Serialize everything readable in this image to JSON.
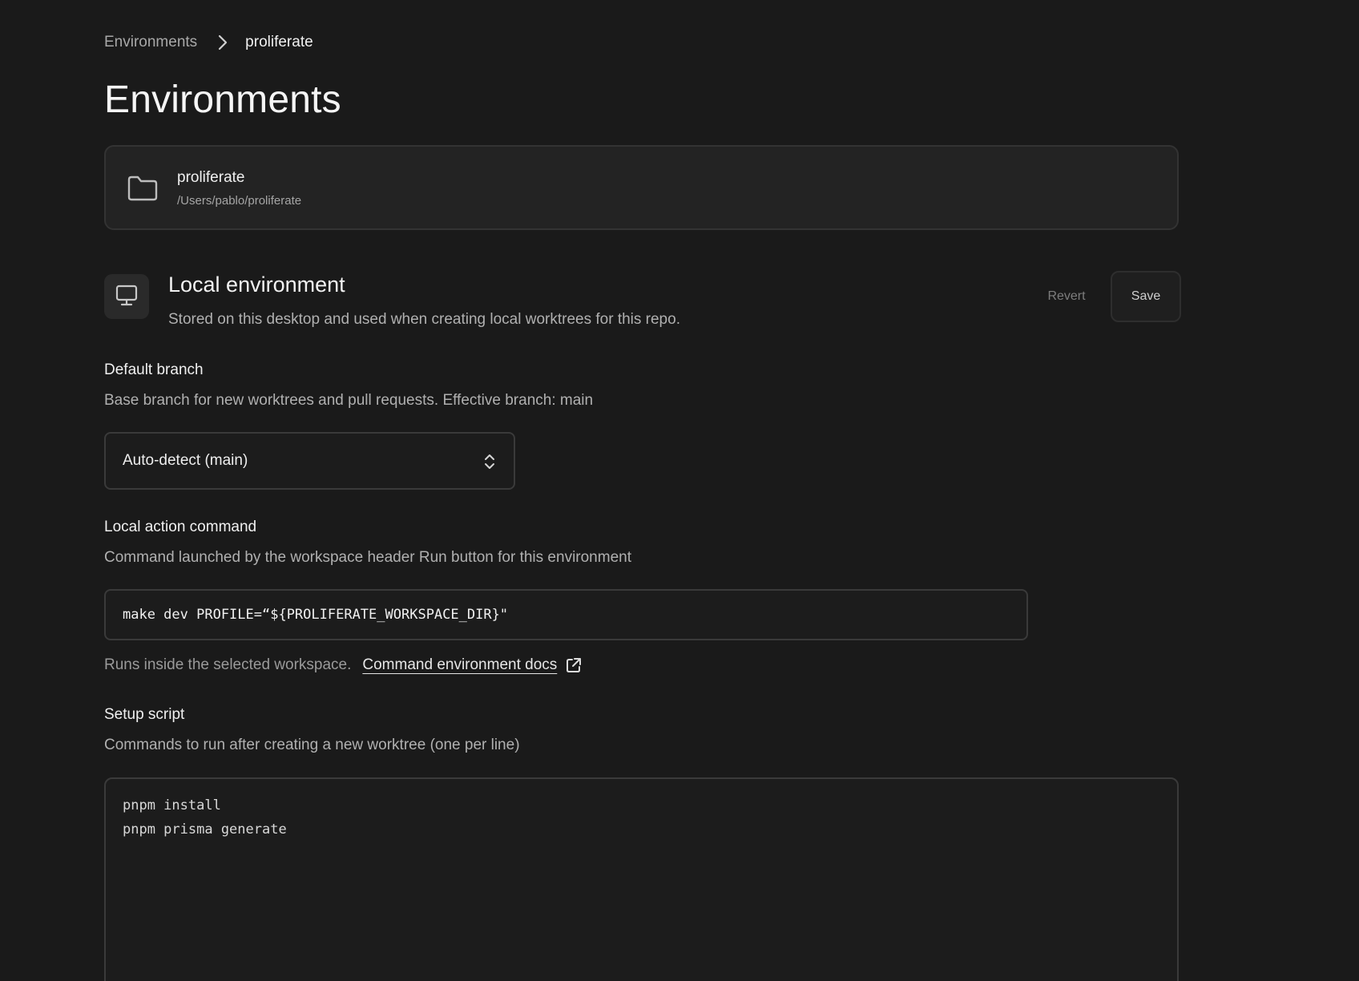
{
  "breadcrumb": {
    "root": "Environments",
    "current": "proliferate"
  },
  "page_title": "Environments",
  "repo": {
    "name": "proliferate",
    "path": "/Users/pablo/proliferate",
    "icon": "folder-icon"
  },
  "local_env": {
    "icon": "monitor-icon",
    "title": "Local environment",
    "description": "Stored on this desktop and used when creating local worktrees for this repo.",
    "revert_label": "Revert",
    "save_label": "Save"
  },
  "default_branch": {
    "label": "Default branch",
    "description": "Base branch for new worktrees and pull requests. Effective branch: main",
    "selected": "Auto-detect (main)"
  },
  "local_action": {
    "label": "Local action command",
    "description": "Command launched by the workspace header Run button for this environment",
    "value": "make dev PROFILE=“${PROLIFERATE_WORKSPACE_DIR}\"",
    "hint": "Runs inside the selected workspace.",
    "docs_link": "Command environment docs"
  },
  "setup_script": {
    "label": "Setup script",
    "description": "Commands to run after creating a new worktree (one per line)",
    "lines": [
      "pnpm install",
      "pnpm prisma generate"
    ]
  }
}
